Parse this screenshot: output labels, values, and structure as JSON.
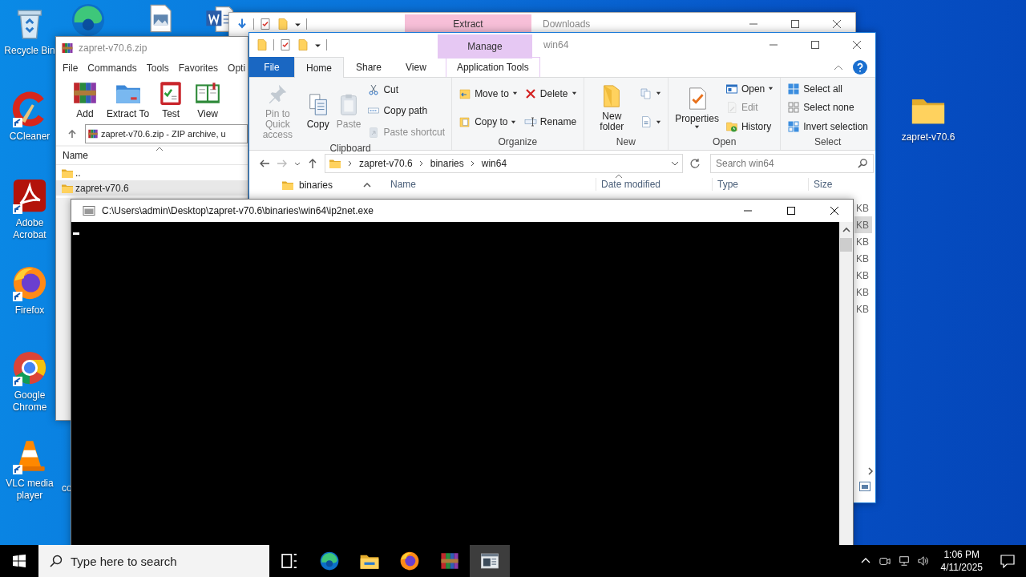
{
  "desktop_icons": [
    {
      "label": "Recycle Bin",
      "kind": "recycle",
      "shortcut": false
    },
    {
      "kind": "edge",
      "shortcut": false
    },
    {
      "kind": "image",
      "shortcut": false
    },
    {
      "kind": "word",
      "shortcut": false
    },
    {
      "label": "CCleaner",
      "kind": "ccleaner",
      "shortcut": true
    },
    {
      "label": "Adobe Acrobat",
      "kind": "acrobat",
      "shortcut": true
    },
    {
      "label": "Firefox",
      "kind": "firefox",
      "shortcut": true
    },
    {
      "label": "Google Chrome",
      "kind": "chrome",
      "shortcut": true
    },
    {
      "label": "VLC media player",
      "kind": "vlc",
      "shortcut": true
    },
    {
      "label": "co",
      "kind": "hidden"
    },
    {
      "label": "zapret-v70.6",
      "kind": "folder",
      "shortcut": false
    }
  ],
  "downloads_window": {
    "context_tab": "Extract",
    "title": "Downloads"
  },
  "winrar_window": {
    "title": "zapret-v70.6.zip",
    "menu": [
      "File",
      "Commands",
      "Tools",
      "Favorites",
      "Opti"
    ],
    "toolbar": [
      {
        "label": "Add",
        "kind": "winrar"
      },
      {
        "label": "Extract To",
        "kind": "bluefolder"
      },
      {
        "label": "Test",
        "kind": "test"
      },
      {
        "label": "View",
        "kind": "book"
      }
    ],
    "path": "zapret-v70.6.zip - ZIP archive, u",
    "column": "Name",
    "rows": [
      {
        "name": "..",
        "selected": false
      },
      {
        "name": "zapret-v70.6",
        "selected": true
      }
    ]
  },
  "explorer_window": {
    "context_header": "Manage",
    "title": "win64",
    "tabs": [
      {
        "label": "File",
        "kind": "file",
        "selected": false
      },
      {
        "label": "Home",
        "kind": "tab",
        "selected": true
      },
      {
        "label": "Share",
        "kind": "tab",
        "selected": false
      },
      {
        "label": "View",
        "kind": "tab",
        "selected": false
      },
      {
        "label": "Application Tools",
        "kind": "context",
        "selected": false
      }
    ],
    "ribbon_groups": [
      {
        "label": "Clipboard",
        "columns": [
          [
            {
              "label": "Pin to Quick access",
              "kind": "pin",
              "large": true,
              "disabled": true,
              "dropdown": false
            }
          ],
          [
            {
              "label": "Copy",
              "kind": "copy",
              "large": true,
              "disabled": false,
              "dropdown": false
            }
          ],
          [
            {
              "label": "Paste",
              "kind": "paste",
              "large": true,
              "disabled": true,
              "dropdown": false
            }
          ],
          [
            {
              "label": "Cut",
              "kind": "cut",
              "large": false,
              "disabled": false,
              "dropdown": false
            },
            {
              "label": "Copy path",
              "kind": "copypath",
              "large": false,
              "disabled": false,
              "dropdown": false
            },
            {
              "label": "Paste shortcut",
              "kind": "pasteshortcut",
              "large": false,
              "disabled": true,
              "dropdown": false
            }
          ]
        ]
      },
      {
        "label": "Organize",
        "columns": [
          [
            {
              "label": "Move to",
              "kind": "moveto",
              "large": false,
              "disabled": false,
              "dropdown": true
            },
            {
              "label": "Copy to",
              "kind": "copyto",
              "large": false,
              "disabled": false,
              "dropdown": true
            }
          ],
          [
            {
              "label": "Delete",
              "kind": "delete",
              "large": false,
              "disabled": false,
              "dropdown": true
            },
            {
              "label": "Rename",
              "kind": "rename",
              "large": false,
              "disabled": false,
              "dropdown": false
            }
          ]
        ]
      },
      {
        "label": "New",
        "columns": [
          [
            {
              "label": "New folder",
              "kind": "newfolder",
              "large": true,
              "disabled": false,
              "dropdown": false
            }
          ],
          [
            {
              "kind": "newitem",
              "large": false,
              "disabled": false,
              "dropdown": true
            },
            {
              "kind": "easyaccess",
              "large": false,
              "disabled": false,
              "dropdown": true
            }
          ]
        ]
      },
      {
        "label": "Open",
        "columns": [
          [
            {
              "label": "Properties",
              "kind": "properties",
              "large": true,
              "disabled": false,
              "dropdown": true
            }
          ],
          [
            {
              "label": "Open",
              "kind": "open",
              "large": false,
              "disabled": false,
              "dropdown": true
            },
            {
              "label": "Edit",
              "kind": "edit",
              "large": false,
              "disabled": true,
              "dropdown": false
            },
            {
              "label": "History",
              "kind": "history",
              "large": false,
              "disabled": false,
              "dropdown": false
            }
          ]
        ]
      },
      {
        "label": "Select",
        "columns": [
          [
            {
              "label": "Select all",
              "kind": "selectall",
              "large": false,
              "disabled": false,
              "dropdown": false
            },
            {
              "label": "Select none",
              "kind": "selectnone",
              "large": false,
              "disabled": false,
              "dropdown": false
            },
            {
              "label": "Invert selection",
              "kind": "invert",
              "large": false,
              "disabled": false,
              "dropdown": false
            }
          ]
        ]
      }
    ],
    "breadcrumbs": [
      "zapret-v70.6",
      "binaries",
      "win64"
    ],
    "search": {
      "placeholder": "Search win64"
    },
    "nav_pane": [
      "binaries"
    ],
    "columns": [
      "Name",
      "Date modified",
      "Type",
      "Size"
    ],
    "rows": [
      {
        "size": "KB",
        "selected": false
      },
      {
        "size": "KB",
        "selected": true
      },
      {
        "size": "KB",
        "selected": false
      },
      {
        "size": "KB",
        "selected": false
      },
      {
        "size": "KB",
        "selected": false
      },
      {
        "size": "KB",
        "selected": false
      },
      {
        "size": "KB",
        "selected": false
      }
    ]
  },
  "console_window": {
    "title": "C:\\Users\\admin\\Desktop\\zapret-v70.6\\binaries\\win64\\ip2net.exe"
  },
  "taskbar": {
    "search": {
      "placeholder": "Type here to search"
    },
    "apps": [
      {
        "kind": "taskview",
        "selected": false
      },
      {
        "kind": "edge",
        "selected": false
      },
      {
        "kind": "explorer",
        "selected": false
      },
      {
        "kind": "firefox",
        "selected": false
      },
      {
        "kind": "winrar",
        "selected": false
      },
      {
        "kind": "console",
        "selected": true
      }
    ],
    "clock": {
      "time": "1:06 PM",
      "date": "4/11/2025"
    }
  }
}
